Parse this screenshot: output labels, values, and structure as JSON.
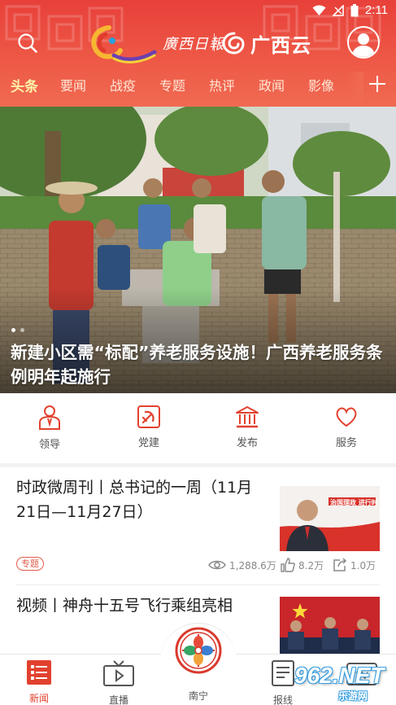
{
  "status_bar": {
    "time": "2:11",
    "icons": [
      "wifi-icon",
      "signal-off-icon",
      "battery-icon"
    ]
  },
  "brand": {
    "paper_name": "廣西日報",
    "cloud_name": "广西云"
  },
  "tabs": [
    {
      "label": "头条",
      "active": true
    },
    {
      "label": "要闻",
      "active": false
    },
    {
      "label": "战疫",
      "active": false
    },
    {
      "label": "专题",
      "active": false
    },
    {
      "label": "热评",
      "active": false
    },
    {
      "label": "政闻",
      "active": false
    },
    {
      "label": "影像",
      "active": false
    }
  ],
  "hero": {
    "caption": "新建小区需“标配”养老服务设施！广西养老服务条例明年起施行",
    "dot_count": 2,
    "active_dot": 1
  },
  "shortcuts": [
    {
      "label": "领导",
      "icon": "leader-icon"
    },
    {
      "label": "党建",
      "icon": "party-emblem-icon"
    },
    {
      "label": "发布",
      "icon": "government-building-icon"
    },
    {
      "label": "服务",
      "icon": "heart-icon"
    }
  ],
  "news": [
    {
      "title": "时政微周刊丨总书记的一周（11月21日—11月27日）",
      "tag": "专题",
      "views": "1,288.6万",
      "likes": "8.2万",
      "shares": "1.0万",
      "thumb_text": "治国理政 进行时"
    },
    {
      "title": "视频丨神舟十五号飞行乘组亮相"
    }
  ],
  "bottom_nav": [
    {
      "label": "新闻",
      "icon": "news-list-icon",
      "active": true
    },
    {
      "label": "直播",
      "icon": "tv-icon",
      "active": false
    },
    {
      "label": "南宁",
      "icon": "city-emblem-icon",
      "active": false
    },
    {
      "label": "报线",
      "icon": "report-icon",
      "active": false
    },
    {
      "label": "TV",
      "icon": "tv-channel-icon",
      "active": false
    }
  ],
  "watermark": {
    "main": "962.NET",
    "sub": "乐游网"
  },
  "colors": {
    "brand_red": "#e8403a",
    "tab_active": "#fff4a8",
    "accent": "#e25b4a"
  }
}
